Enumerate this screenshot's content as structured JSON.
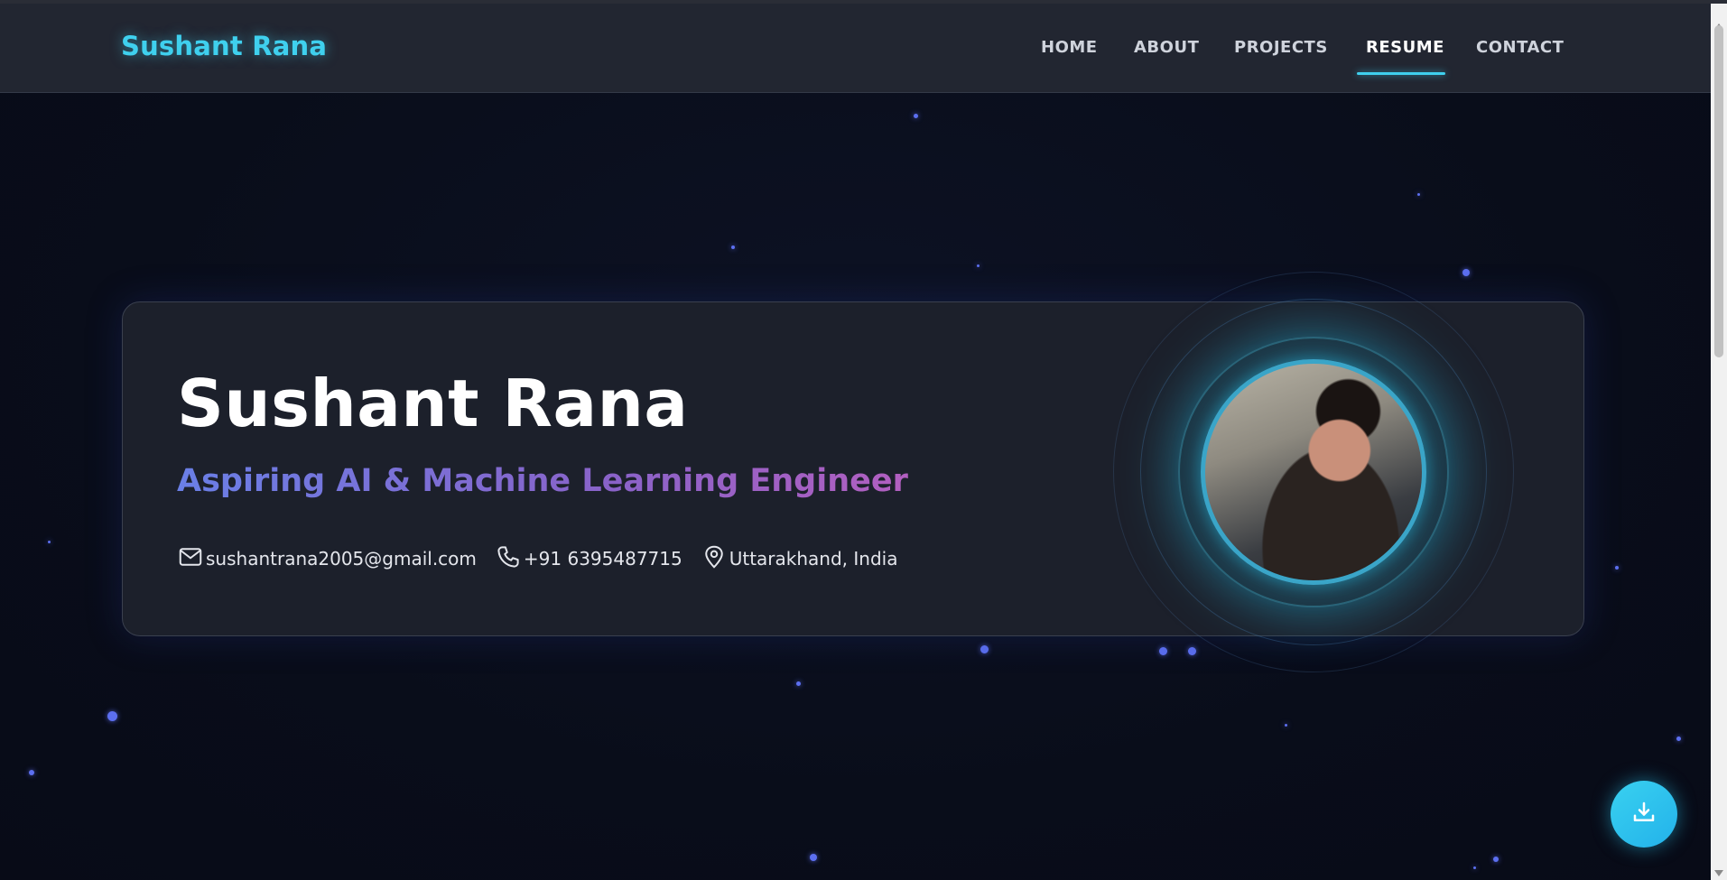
{
  "brand": "Sushant Rana",
  "nav": {
    "items": [
      {
        "label": "HOME"
      },
      {
        "label": "ABOUT"
      },
      {
        "label": "PROJECTS"
      },
      {
        "label": "RESUME",
        "active": true
      },
      {
        "label": "CONTACT"
      }
    ]
  },
  "hero": {
    "name": "Sushant Rana",
    "role": "Aspiring AI & Machine Learning Engineer",
    "email": "sushantrana2005@gmail.com",
    "phone": "+91 6395487715",
    "location": "Uttarakhand, India",
    "email_icon": "mail-icon",
    "phone_icon": "phone-icon",
    "location_icon": "map-pin-icon",
    "avatar": "profile-photo"
  },
  "fab": {
    "icon": "download-icon"
  },
  "colors": {
    "accent": "#3fd0ee",
    "background": "#0a0e1c",
    "card": "#1c202b",
    "particle": "#5c6ff0"
  }
}
